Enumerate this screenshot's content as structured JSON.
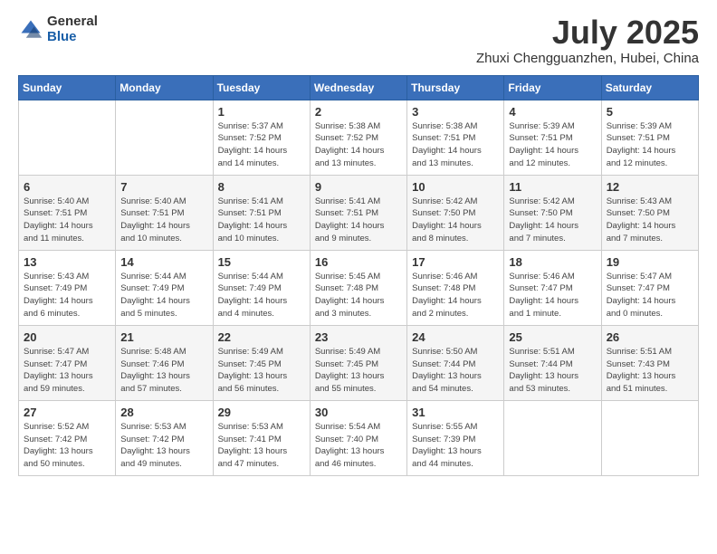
{
  "header": {
    "logo_general": "General",
    "logo_blue": "Blue",
    "month_title": "July 2025",
    "location": "Zhuxi Chengguanzhen, Hubei, China"
  },
  "weekdays": [
    "Sunday",
    "Monday",
    "Tuesday",
    "Wednesday",
    "Thursday",
    "Friday",
    "Saturday"
  ],
  "weeks": [
    [
      {
        "day": "",
        "info": ""
      },
      {
        "day": "",
        "info": ""
      },
      {
        "day": "1",
        "info": "Sunrise: 5:37 AM\nSunset: 7:52 PM\nDaylight: 14 hours\nand 14 minutes."
      },
      {
        "day": "2",
        "info": "Sunrise: 5:38 AM\nSunset: 7:52 PM\nDaylight: 14 hours\nand 13 minutes."
      },
      {
        "day": "3",
        "info": "Sunrise: 5:38 AM\nSunset: 7:51 PM\nDaylight: 14 hours\nand 13 minutes."
      },
      {
        "day": "4",
        "info": "Sunrise: 5:39 AM\nSunset: 7:51 PM\nDaylight: 14 hours\nand 12 minutes."
      },
      {
        "day": "5",
        "info": "Sunrise: 5:39 AM\nSunset: 7:51 PM\nDaylight: 14 hours\nand 12 minutes."
      }
    ],
    [
      {
        "day": "6",
        "info": "Sunrise: 5:40 AM\nSunset: 7:51 PM\nDaylight: 14 hours\nand 11 minutes."
      },
      {
        "day": "7",
        "info": "Sunrise: 5:40 AM\nSunset: 7:51 PM\nDaylight: 14 hours\nand 10 minutes."
      },
      {
        "day": "8",
        "info": "Sunrise: 5:41 AM\nSunset: 7:51 PM\nDaylight: 14 hours\nand 10 minutes."
      },
      {
        "day": "9",
        "info": "Sunrise: 5:41 AM\nSunset: 7:51 PM\nDaylight: 14 hours\nand 9 minutes."
      },
      {
        "day": "10",
        "info": "Sunrise: 5:42 AM\nSunset: 7:50 PM\nDaylight: 14 hours\nand 8 minutes."
      },
      {
        "day": "11",
        "info": "Sunrise: 5:42 AM\nSunset: 7:50 PM\nDaylight: 14 hours\nand 7 minutes."
      },
      {
        "day": "12",
        "info": "Sunrise: 5:43 AM\nSunset: 7:50 PM\nDaylight: 14 hours\nand 7 minutes."
      }
    ],
    [
      {
        "day": "13",
        "info": "Sunrise: 5:43 AM\nSunset: 7:49 PM\nDaylight: 14 hours\nand 6 minutes."
      },
      {
        "day": "14",
        "info": "Sunrise: 5:44 AM\nSunset: 7:49 PM\nDaylight: 14 hours\nand 5 minutes."
      },
      {
        "day": "15",
        "info": "Sunrise: 5:44 AM\nSunset: 7:49 PM\nDaylight: 14 hours\nand 4 minutes."
      },
      {
        "day": "16",
        "info": "Sunrise: 5:45 AM\nSunset: 7:48 PM\nDaylight: 14 hours\nand 3 minutes."
      },
      {
        "day": "17",
        "info": "Sunrise: 5:46 AM\nSunset: 7:48 PM\nDaylight: 14 hours\nand 2 minutes."
      },
      {
        "day": "18",
        "info": "Sunrise: 5:46 AM\nSunset: 7:47 PM\nDaylight: 14 hours\nand 1 minute."
      },
      {
        "day": "19",
        "info": "Sunrise: 5:47 AM\nSunset: 7:47 PM\nDaylight: 14 hours\nand 0 minutes."
      }
    ],
    [
      {
        "day": "20",
        "info": "Sunrise: 5:47 AM\nSunset: 7:47 PM\nDaylight: 13 hours\nand 59 minutes."
      },
      {
        "day": "21",
        "info": "Sunrise: 5:48 AM\nSunset: 7:46 PM\nDaylight: 13 hours\nand 57 minutes."
      },
      {
        "day": "22",
        "info": "Sunrise: 5:49 AM\nSunset: 7:45 PM\nDaylight: 13 hours\nand 56 minutes."
      },
      {
        "day": "23",
        "info": "Sunrise: 5:49 AM\nSunset: 7:45 PM\nDaylight: 13 hours\nand 55 minutes."
      },
      {
        "day": "24",
        "info": "Sunrise: 5:50 AM\nSunset: 7:44 PM\nDaylight: 13 hours\nand 54 minutes."
      },
      {
        "day": "25",
        "info": "Sunrise: 5:51 AM\nSunset: 7:44 PM\nDaylight: 13 hours\nand 53 minutes."
      },
      {
        "day": "26",
        "info": "Sunrise: 5:51 AM\nSunset: 7:43 PM\nDaylight: 13 hours\nand 51 minutes."
      }
    ],
    [
      {
        "day": "27",
        "info": "Sunrise: 5:52 AM\nSunset: 7:42 PM\nDaylight: 13 hours\nand 50 minutes."
      },
      {
        "day": "28",
        "info": "Sunrise: 5:53 AM\nSunset: 7:42 PM\nDaylight: 13 hours\nand 49 minutes."
      },
      {
        "day": "29",
        "info": "Sunrise: 5:53 AM\nSunset: 7:41 PM\nDaylight: 13 hours\nand 47 minutes."
      },
      {
        "day": "30",
        "info": "Sunrise: 5:54 AM\nSunset: 7:40 PM\nDaylight: 13 hours\nand 46 minutes."
      },
      {
        "day": "31",
        "info": "Sunrise: 5:55 AM\nSunset: 7:39 PM\nDaylight: 13 hours\nand 44 minutes."
      },
      {
        "day": "",
        "info": ""
      },
      {
        "day": "",
        "info": ""
      }
    ]
  ]
}
